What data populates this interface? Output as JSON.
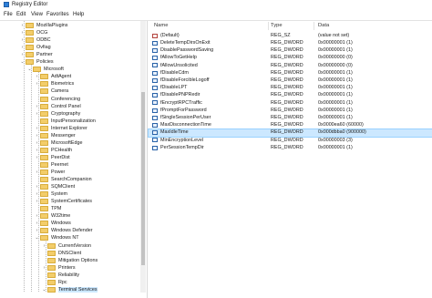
{
  "window": {
    "title": "Registry Editor"
  },
  "menu": [
    "File",
    "Edit",
    "View",
    "Favorites",
    "Help"
  ],
  "tree": {
    "items": [
      {
        "label": "MozillaPlugins",
        "level": 1,
        "expander": "›"
      },
      {
        "label": "OCG",
        "level": 1,
        "expander": "›"
      },
      {
        "label": "ODBC",
        "level": 1,
        "expander": "›"
      },
      {
        "label": "Ovfiag",
        "level": 1,
        "expander": "›"
      },
      {
        "label": "Partner",
        "level": 1,
        "expander": "›"
      },
      {
        "label": "Policies",
        "level": 1,
        "expander": "⌄"
      },
      {
        "label": "Microsoft",
        "level": 2,
        "expander": "⌄"
      },
      {
        "label": "AdtAgent",
        "level": 3,
        "expander": "›"
      },
      {
        "label": "Biometrics",
        "level": 3,
        "expander": "›"
      },
      {
        "label": "Camera",
        "level": 3,
        "expander": ""
      },
      {
        "label": "Conferencing",
        "level": 3,
        "expander": ""
      },
      {
        "label": "Control Panel",
        "level": 3,
        "expander": "›"
      },
      {
        "label": "Cryptography",
        "level": 3,
        "expander": "›"
      },
      {
        "label": "InputPersonalization",
        "level": 3,
        "expander": ""
      },
      {
        "label": "Internet Explorer",
        "level": 3,
        "expander": "›"
      },
      {
        "label": "Messenger",
        "level": 3,
        "expander": "›"
      },
      {
        "label": "MicrosoftEdge",
        "level": 3,
        "expander": "›"
      },
      {
        "label": "PCHealth",
        "level": 3,
        "expander": "›"
      },
      {
        "label": "PeerDist",
        "level": 3,
        "expander": "›"
      },
      {
        "label": "Peernet",
        "level": 3,
        "expander": ""
      },
      {
        "label": "Power",
        "level": 3,
        "expander": "›"
      },
      {
        "label": "SearchCompanion",
        "level": 3,
        "expander": ""
      },
      {
        "label": "SQMClient",
        "level": 3,
        "expander": "›"
      },
      {
        "label": "System",
        "level": 3,
        "expander": "›"
      },
      {
        "label": "SystemCertificates",
        "level": 3,
        "expander": "›"
      },
      {
        "label": "TPM",
        "level": 3,
        "expander": ""
      },
      {
        "label": "W32time",
        "level": 3,
        "expander": "›"
      },
      {
        "label": "Windows",
        "level": 3,
        "expander": "›"
      },
      {
        "label": "Windows Defender",
        "level": 3,
        "expander": "›"
      },
      {
        "label": "Windows NT",
        "level": 3,
        "expander": "⌄"
      },
      {
        "label": "CurrentVersion",
        "level": 4,
        "expander": "›"
      },
      {
        "label": "DNSClient",
        "level": 4,
        "expander": ""
      },
      {
        "label": "Mitigation Options",
        "level": 4,
        "expander": ""
      },
      {
        "label": "Printers",
        "level": 4,
        "expander": "›"
      },
      {
        "label": "Reliability",
        "level": 4,
        "expander": ""
      },
      {
        "label": "Rpc",
        "level": 4,
        "expander": ""
      },
      {
        "label": "Terminal Services",
        "level": 4,
        "expander": "⌄",
        "selected": true
      }
    ]
  },
  "list": {
    "columns": [
      "Name",
      "Type",
      "Data"
    ],
    "rows": [
      {
        "name": "(Default)",
        "type": "REG_SZ",
        "data": "(value not set)",
        "kind": "sz"
      },
      {
        "name": "DeleteTempDirsOnExit",
        "type": "REG_DWORD",
        "data": "0x00000001 (1)",
        "kind": "dword"
      },
      {
        "name": "DisablePasswordSaving",
        "type": "REG_DWORD",
        "data": "0x00000001 (1)",
        "kind": "dword"
      },
      {
        "name": "fAllowToGetHelp",
        "type": "REG_DWORD",
        "data": "0x00000000 (0)",
        "kind": "dword"
      },
      {
        "name": "fAllowUnsolicited",
        "type": "REG_DWORD",
        "data": "0x00000000 (0)",
        "kind": "dword"
      },
      {
        "name": "fDisableCdm",
        "type": "REG_DWORD",
        "data": "0x00000001 (1)",
        "kind": "dword"
      },
      {
        "name": "fDisableForcibleLogoff",
        "type": "REG_DWORD",
        "data": "0x00000001 (1)",
        "kind": "dword"
      },
      {
        "name": "fDisableLPT",
        "type": "REG_DWORD",
        "data": "0x00000001 (1)",
        "kind": "dword"
      },
      {
        "name": "fDisablePNPRedir",
        "type": "REG_DWORD",
        "data": "0x00000001 (1)",
        "kind": "dword"
      },
      {
        "name": "fEncryptRPCTraffic",
        "type": "REG_DWORD",
        "data": "0x00000001 (1)",
        "kind": "dword"
      },
      {
        "name": "fPromptForPassword",
        "type": "REG_DWORD",
        "data": "0x00000001 (1)",
        "kind": "dword"
      },
      {
        "name": "fSingleSessionPerUser",
        "type": "REG_DWORD",
        "data": "0x00000001 (1)",
        "kind": "dword"
      },
      {
        "name": "MaxDisconnectionTime",
        "type": "REG_DWORD",
        "data": "0x0000ea60 (60000)",
        "kind": "dword"
      },
      {
        "name": "MaxIdleTime",
        "type": "REG_DWORD",
        "data": "0x000dbba0 (900000)",
        "kind": "dword",
        "selected": true
      },
      {
        "name": "MinEncryptionLevel",
        "type": "REG_DWORD",
        "data": "0x00000003 (3)",
        "kind": "dword"
      },
      {
        "name": "PerSessionTempDir",
        "type": "REG_DWORD",
        "data": "0x00000001 (1)",
        "kind": "dword"
      }
    ]
  }
}
